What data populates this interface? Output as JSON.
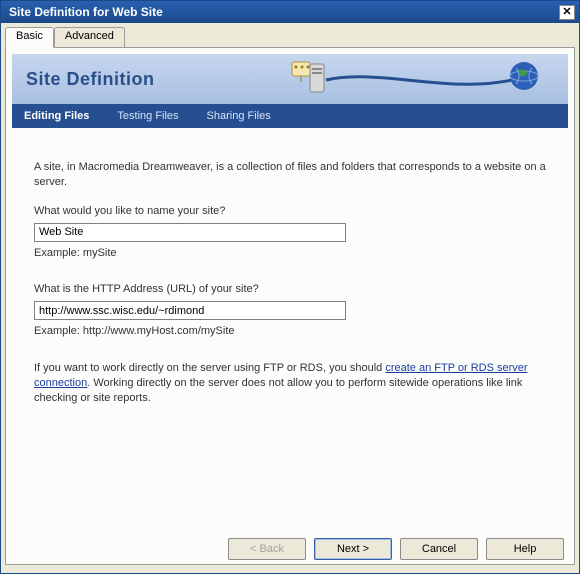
{
  "window": {
    "title": "Site Definition for Web Site",
    "close_glyph": "✕"
  },
  "tabs": {
    "basic": "Basic",
    "advanced": "Advanced"
  },
  "banner": {
    "title": "Site Definition"
  },
  "subnav": {
    "editing": "Editing Files",
    "testing": "Testing Files",
    "sharing": "Sharing Files"
  },
  "content": {
    "intro": "A site, in Macromedia Dreamweaver, is a collection of files and folders that corresponds to a website on a server.",
    "name_label": "What would you like to name your site?",
    "name_value": "Web Site",
    "name_example": "Example: mySite",
    "url_label": "What is the HTTP Address (URL) of your site?",
    "url_value": "http://www.ssc.wisc.edu/~rdimond",
    "url_example": "Example: http://www.myHost.com/mySite",
    "advice_pre": "If you want to work directly on the server using FTP or RDS, you should ",
    "advice_link": "create an FTP or RDS server connection",
    "advice_post": ".  Working directly on the server does not allow you to perform sitewide operations like link checking or site reports."
  },
  "buttons": {
    "back": "< Back",
    "next": "Next >",
    "cancel": "Cancel",
    "help": "Help"
  }
}
